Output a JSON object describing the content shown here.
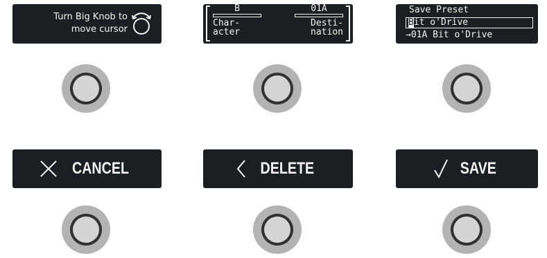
{
  "displays": {
    "cursor_hint": {
      "line1": "Turn Big Knob to",
      "line2": "move cursor",
      "icon": "rotate-knob-icon"
    },
    "scribble": {
      "character_value": "B",
      "destination_value": "01A",
      "character_label_1": "Char-",
      "character_label_2": "acter",
      "destination_label_1": "Desti-",
      "destination_label_2": "nation"
    },
    "save_preset": {
      "title": "Save Preset",
      "name_cursor_char": "B",
      "name_rest": "it o'Drive",
      "destination": "→01A Bit o'Drive"
    }
  },
  "actions": {
    "cancel": {
      "label": "CANCEL",
      "icon": "x-icon"
    },
    "delete": {
      "label": "DELETE",
      "icon": "chevron-left-icon"
    },
    "save": {
      "label": "SAVE",
      "icon": "checkmark-icon"
    }
  },
  "colors": {
    "panel": "#1b1e22",
    "text": "#f2f2f2",
    "switch_outer": "#b3b3b3",
    "switch_ring": "#313131",
    "switch_cap": "#d4d4d4"
  }
}
